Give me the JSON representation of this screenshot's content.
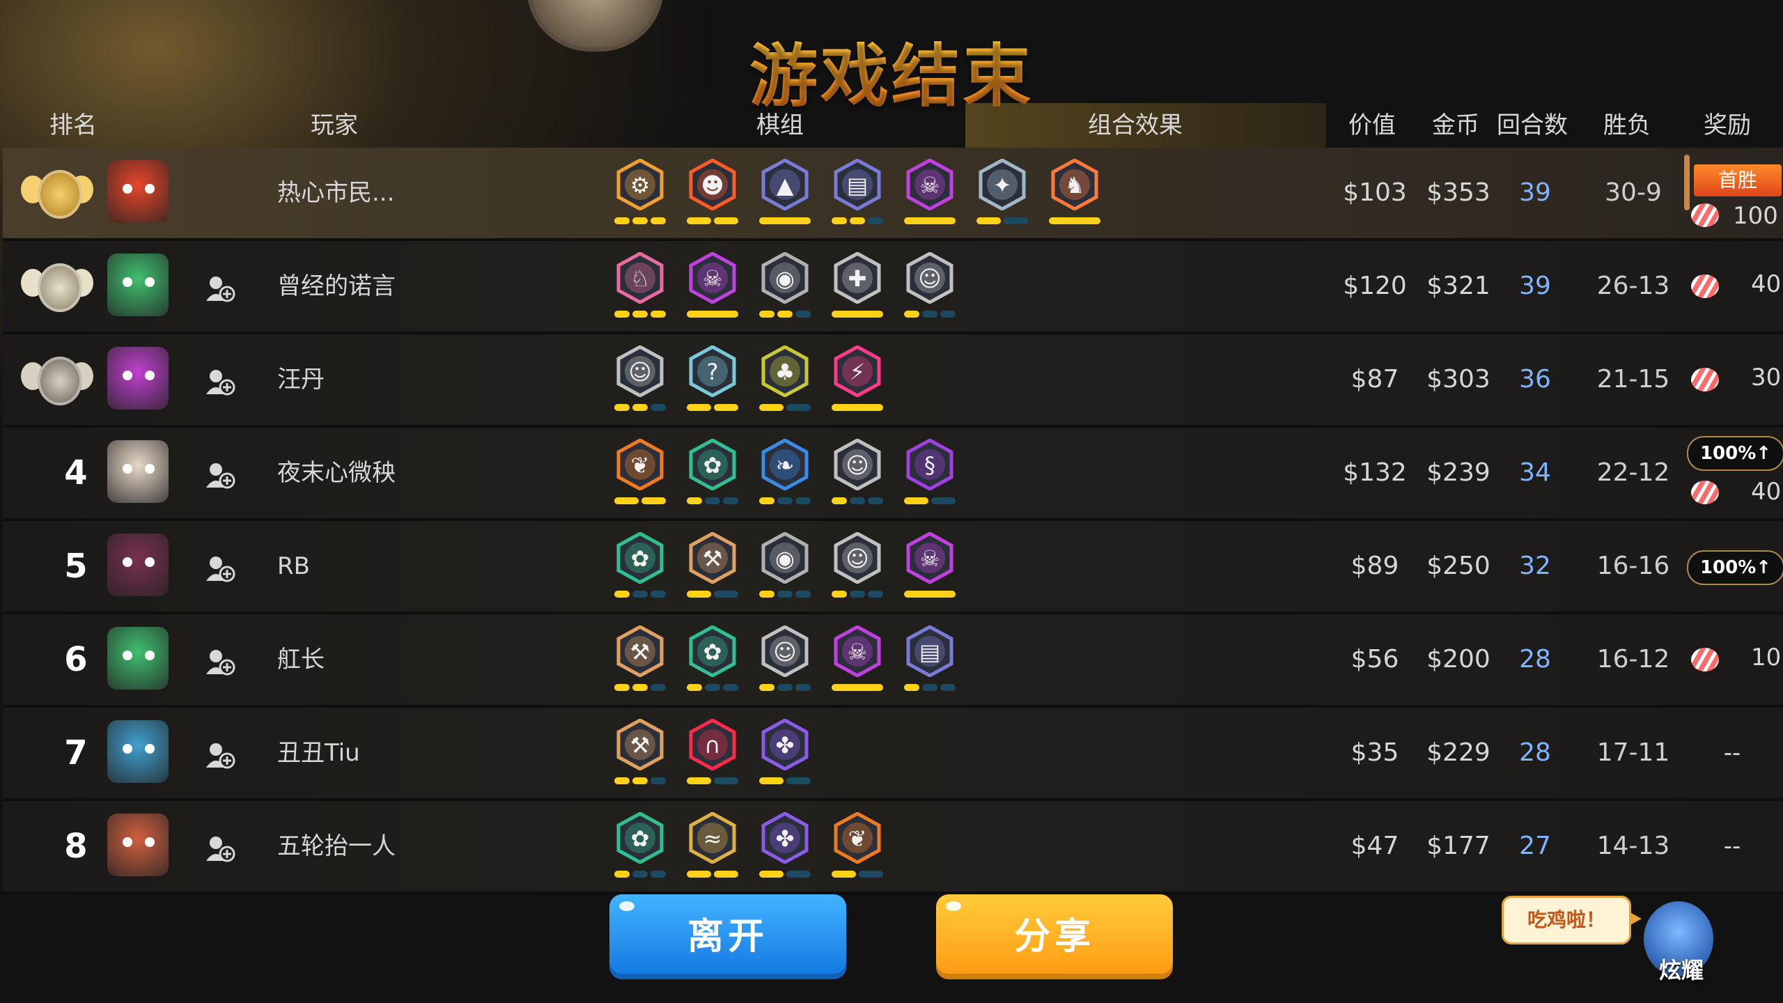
{
  "title": "游戏结束",
  "headers": {
    "rank": "排名",
    "player": "玩家",
    "traits": "棋组",
    "combo": "组合效果",
    "value": "价值",
    "gold": "金币",
    "rounds": "回合数",
    "record": "胜负",
    "reward": "奖励"
  },
  "rows": [
    {
      "rank": "1",
      "rank_badge": "gold-crown",
      "name": "热心市民...",
      "avatar_color": "#e8462a",
      "value": "$103",
      "gold": "$353",
      "rounds": "39",
      "record": "30-9",
      "reward": {
        "flag": "首胜",
        "candy": "100"
      },
      "traits": [
        {
          "icon": "gear",
          "color": "#f0a030",
          "pips": [
            1,
            1,
            1
          ]
        },
        {
          "icon": "mask",
          "color": "#ff5a2a",
          "pips": [
            1,
            1
          ]
        },
        {
          "icon": "wizard-hat",
          "color": "#7a7ad8",
          "pips": [
            1
          ]
        },
        {
          "icon": "spellbook",
          "color": "#7a7ad8",
          "pips": [
            1,
            1,
            0
          ]
        },
        {
          "icon": "demon",
          "color": "#c040e0",
          "pips": [
            1
          ]
        },
        {
          "icon": "assassin",
          "color": "#9fb8c8",
          "pips": [
            1,
            0
          ]
        },
        {
          "icon": "beast",
          "color": "#ff7a3a",
          "pips": [
            1
          ]
        }
      ]
    },
    {
      "rank": "2",
      "rank_badge": "silver-crown",
      "name": "曾经的诺言",
      "avatar_color": "#40c070",
      "value": "$120",
      "gold": "$321",
      "rounds": "39",
      "record": "26-13",
      "reward": {
        "candy": "40"
      },
      "traits": [
        {
          "icon": "knight",
          "color": "#e86aa0",
          "pips": [
            1,
            1,
            1
          ]
        },
        {
          "icon": "demon",
          "color": "#c040e0",
          "pips": [
            1
          ]
        },
        {
          "icon": "turtle",
          "color": "#b0b0b0",
          "pips": [
            1,
            1,
            0
          ]
        },
        {
          "icon": "cross",
          "color": "#c0c0c0",
          "pips": [
            1
          ]
        },
        {
          "icon": "human",
          "color": "#c0c0c0",
          "pips": [
            1,
            0,
            0
          ]
        }
      ]
    },
    {
      "rank": "3",
      "rank_badge": "bronze-crown",
      "name": "汪丹",
      "avatar_color": "#c040d0",
      "value": "$87",
      "gold": "$303",
      "rounds": "36",
      "record": "21-15",
      "reward": {
        "candy": "30"
      },
      "traits": [
        {
          "icon": "human",
          "color": "#c0c0c0",
          "pips": [
            1,
            1,
            0
          ]
        },
        {
          "icon": "shaman",
          "color": "#7ac8d8",
          "pips": [
            1,
            1
          ]
        },
        {
          "icon": "goblin",
          "color": "#c8c830",
          "pips": [
            1,
            0
          ]
        },
        {
          "icon": "dragon",
          "color": "#ff3a8a",
          "pips": [
            1
          ]
        }
      ]
    },
    {
      "rank": "4",
      "rank_badge": "",
      "name": "夜末心微秧",
      "avatar_color": "#e8d8c8",
      "value": "$132",
      "gold": "$239",
      "rounds": "34",
      "record": "22-12",
      "reward": {
        "pct": "100%↑",
        "candy": "40"
      },
      "traits": [
        {
          "icon": "feather",
          "color": "#f07a20",
          "pips": [
            1,
            1
          ]
        },
        {
          "icon": "paw",
          "color": "#30c090",
          "pips": [
            1,
            0,
            0
          ]
        },
        {
          "icon": "blade",
          "color": "#3a8ae8",
          "pips": [
            1,
            0,
            0
          ]
        },
        {
          "icon": "human",
          "color": "#c0c0c0",
          "pips": [
            1,
            0,
            0
          ]
        },
        {
          "icon": "cobra",
          "color": "#a040e0",
          "pips": [
            1,
            0
          ]
        }
      ]
    },
    {
      "rank": "5",
      "rank_badge": "",
      "name": "RB",
      "avatar_color": "#7a3050",
      "value": "$89",
      "gold": "$250",
      "rounds": "32",
      "record": "16-16",
      "reward": {
        "pct": "100%↑"
      },
      "traits": [
        {
          "icon": "paw",
          "color": "#30c090",
          "pips": [
            1,
            0,
            0
          ]
        },
        {
          "icon": "axe",
          "color": "#e0a060",
          "pips": [
            1,
            0
          ]
        },
        {
          "icon": "turtle",
          "color": "#b0b0b0",
          "pips": [
            1,
            0,
            0
          ]
        },
        {
          "icon": "human",
          "color": "#c0c0c0",
          "pips": [
            1,
            0,
            0
          ]
        },
        {
          "icon": "demon",
          "color": "#c040e0",
          "pips": [
            1
          ]
        }
      ]
    },
    {
      "rank": "6",
      "rank_badge": "",
      "name": "舡长",
      "avatar_color": "#40c070",
      "value": "$56",
      "gold": "$200",
      "rounds": "28",
      "record": "16-12",
      "reward": {
        "candy": "10"
      },
      "traits": [
        {
          "icon": "axe",
          "color": "#e0a060",
          "pips": [
            1,
            1,
            0
          ]
        },
        {
          "icon": "paw",
          "color": "#30c090",
          "pips": [
            1,
            0,
            0
          ]
        },
        {
          "icon": "human",
          "color": "#c0c0c0",
          "pips": [
            1,
            0,
            0
          ]
        },
        {
          "icon": "demon",
          "color": "#c040e0",
          "pips": [
            1
          ]
        },
        {
          "icon": "spellbook",
          "color": "#7a7ad8",
          "pips": [
            1,
            0,
            0
          ]
        }
      ]
    },
    {
      "rank": "7",
      "rank_badge": "",
      "name": "丑丑Tiu",
      "avatar_color": "#40a0d0",
      "value": "$35",
      "gold": "$229",
      "rounds": "28",
      "record": "17-11",
      "reward": {
        "dash": "--"
      },
      "traits": [
        {
          "icon": "axe",
          "color": "#e0a060",
          "pips": [
            1,
            1,
            0
          ]
        },
        {
          "icon": "horseshoe",
          "color": "#ff2a4a",
          "pips": [
            1,
            0
          ]
        },
        {
          "icon": "fishbone",
          "color": "#8a5ae8",
          "pips": [
            1,
            0
          ]
        }
      ]
    },
    {
      "rank": "8",
      "rank_badge": "",
      "name": "五轮抬一人",
      "avatar_color": "#d06040",
      "value": "$47",
      "gold": "$177",
      "rounds": "27",
      "record": "14-13",
      "reward": {
        "dash": "--"
      },
      "traits": [
        {
          "icon": "paw",
          "color": "#30c090",
          "pips": [
            1,
            0,
            0
          ]
        },
        {
          "icon": "claw",
          "color": "#e0b040",
          "pips": [
            1,
            1
          ]
        },
        {
          "icon": "fishbone",
          "color": "#8a5ae8",
          "pips": [
            1,
            0
          ]
        },
        {
          "icon": "feather",
          "color": "#f07a20",
          "pips": [
            1,
            0
          ]
        }
      ]
    }
  ],
  "buttons": {
    "leave": "离开",
    "share": "分享"
  },
  "show_off": {
    "bubble": "吃鸡啦！",
    "label": "炫耀"
  }
}
